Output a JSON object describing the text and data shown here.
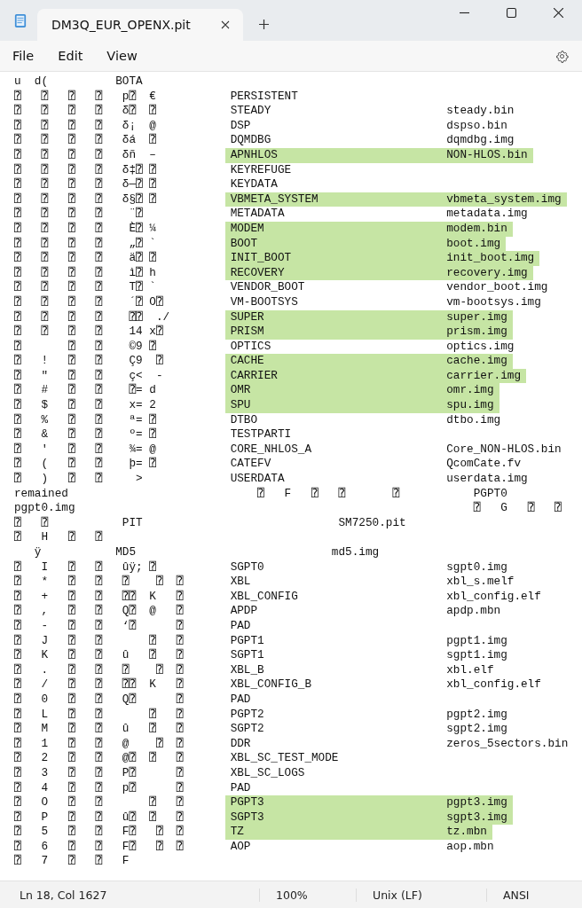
{
  "tabs": [
    {
      "label": "DM3Q_EUR_OPENX.pit",
      "selected": true
    }
  ],
  "menu": [
    "File",
    "Edit",
    "View"
  ],
  "lines": [
    {
      "kind": "text",
      "text": "u  d(          BOTA"
    },
    {
      "kind": "entry",
      "left": "⍰\t⍰\t⍰\t⍰\tp⍰\t€",
      "name": "PERSISTENT",
      "highlighted": false
    },
    {
      "kind": "entry",
      "left": "⍰\t⍰\t⍰\t⍰\tδ⍰\t⍰",
      "name": "STEADY",
      "file": "steady.bin",
      "highlighted": false
    },
    {
      "kind": "entry",
      "left": "⍰\t⍰\t⍰\t⍰\tδ¡\t@",
      "name": "DSP",
      "file": "dspso.bin",
      "highlighted": false
    },
    {
      "kind": "entry",
      "left": "⍰\t⍰\t⍰\t⍰\tδá\t⍰",
      "name": "DQMDBG",
      "file": "dqmdbg.img",
      "highlighted": false
    },
    {
      "kind": "entry",
      "left": "⍰\t⍰\t⍰\t⍰\tδñ\t–",
      "name": "APNHLOS",
      "file": "NON-HLOS.bin",
      "highlighted": true
    },
    {
      "kind": "entry",
      "left": "⍰\t⍰\t⍰\t⍰\tδ‡⍰\t⍰",
      "name": "KEYREFUGE",
      "highlighted": false
    },
    {
      "kind": "entry",
      "left": "⍰\t⍰\t⍰\t⍰\tδ—⍰\t⍰",
      "name": "KEYDATA",
      "highlighted": false
    },
    {
      "kind": "entry",
      "left": "⍰\t⍰\t⍰\t⍰\tδ§⍰ ⍰",
      "name": "VBMETA_SYSTEM",
      "file": "vbmeta_system.img",
      "highlighted": true
    },
    {
      "kind": "entry",
      "left": "⍰\t⍰\t⍰\t⍰\t ¨⍰",
      "name": "METADATA",
      "file": "metadata.img",
      "highlighted": false
    },
    {
      "kind": "entry",
      "left": "⍰\t⍰\t⍰\t⍰\t È⍰\t¼",
      "name": "MODEM",
      "file": "modem.bin",
      "highlighted": true
    },
    {
      "kind": "entry",
      "left": "⍰\t⍰\t⍰\t⍰\t „⍰\t`",
      "name": "BOOT",
      "file": "boot.img",
      "highlighted": true
    },
    {
      "kind": "entry",
      "left": "⍰\t⍰\t⍰\t⍰\t ä⍰\t⍰",
      "name": "INIT_BOOT",
      "file": "init_boot.img",
      "highlighted": true
    },
    {
      "kind": "entry",
      "left": "⍰\t⍰\t⍰\t⍰\t ì⍰\th",
      "name": "RECOVERY",
      "file": "recovery.img",
      "highlighted": true
    },
    {
      "kind": "entry",
      "left": "⍰\t⍰\t⍰\t⍰\t T⍰\t`",
      "name": "VENDOR_BOOT",
      "file": "vendor_boot.img",
      "highlighted": false
    },
    {
      "kind": "entry",
      "left": "⍰\t⍰\t⍰\t⍰\t ´⍰\tO⍰",
      "name": "VM-BOOTSYS",
      "file": "vm-bootsys.img",
      "highlighted": false
    },
    {
      "kind": "entry",
      "left": "⍰\t⍰\t⍰\t⍰\t ⍰⍰\t ./",
      "name": "SUPER",
      "file": "super.img",
      "highlighted": true
    },
    {
      "kind": "entry",
      "left": "⍰\t⍰\t⍰\t⍰\t 14\tx⍰",
      "name": "PRISM",
      "file": "prism.img",
      "highlighted": true
    },
    {
      "kind": "entry",
      "left": "⍰\t\t⍰\t⍰\t ©9\t⍰",
      "name": "OPTICS",
      "file": "optics.img",
      "highlighted": false
    },
    {
      "kind": "entry",
      "left": "⍰\t!\t⍰\t⍰\t Ç9\t ⍰",
      "name": "CACHE",
      "file": "cache.img",
      "highlighted": true
    },
    {
      "kind": "entry",
      "left": "⍰\t\"\t⍰\t⍰\t ç<\t -",
      "name": "CARRIER",
      "file": "carrier.img",
      "highlighted": true
    },
    {
      "kind": "entry",
      "left": "⍰\t#\t⍰\t⍰\t ⍰=\td",
      "name": "OMR",
      "file": "omr.img",
      "highlighted": true
    },
    {
      "kind": "entry",
      "left": "⍰\t$\t⍰\t⍰\t x=\t2",
      "name": "SPU",
      "file": "spu.img",
      "highlighted": true
    },
    {
      "kind": "entry",
      "left": "⍰\t%\t⍰\t⍰\t ª=\t⍰",
      "name": "DTBO",
      "file": "dtbo.img",
      "highlighted": false
    },
    {
      "kind": "entry",
      "left": "⍰\t&\t⍰\t⍰\t º=\t⍰",
      "name": "TESTPARTI",
      "highlighted": false
    },
    {
      "kind": "entry",
      "left": "⍰\t'\t⍰\t⍰\t ¾=\t@",
      "name": "CORE_NHLOS_A",
      "file": "Core_NON-HLOS.bin",
      "highlighted": false
    },
    {
      "kind": "entry",
      "left": "⍰\t(\t⍰\t⍰\t þ=\t⍰",
      "name": "CATEFV",
      "file": "QcomCate.fv",
      "highlighted": false
    },
    {
      "kind": "entry",
      "left": "⍰\t)\t⍰\t⍰\t  >",
      "name": "USERDATA",
      "file": "userdata.img",
      "highlighted": false
    },
    {
      "kind": "text",
      "text": "remained\t\t\t\t\t\t\t⍰\tF\t⍰\t⍰\t\t⍰\t\t\tPGPT0"
    },
    {
      "kind": "text",
      "text": "pgpt0.img\t\t\t\t\t\t\t\t\t\t\t\t\t\t\t⍰\tG\t⍰\t⍰"
    },
    {
      "kind": "text",
      "text": "⍰\t⍰\t\t\tPIT\t\t\t\t\t\t\t\tSM7250.pit"
    },
    {
      "kind": "text",
      "text": "⍰\tH\t⍰\t⍰"
    },
    {
      "kind": "text",
      "text": "   ÿ           MD5                             md5.img"
    },
    {
      "kind": "entry",
      "left": "⍰\tI\t⍰\t⍰\tûÿ;\t⍰",
      "name": "SGPT0",
      "file": "sgpt0.img",
      "highlighted": false
    },
    {
      "kind": "entry",
      "left": "⍰\t*\t⍰\t⍰\t⍰\t ⍰\t⍰",
      "name": "XBL",
      "file": "xbl_s.melf",
      "highlighted": false
    },
    {
      "kind": "entry",
      "left": "⍰\t+\t⍰\t⍰\t⍰⍰\tK\t⍰",
      "name": "XBL_CONFIG",
      "file": "xbl_config.elf",
      "highlighted": false
    },
    {
      "kind": "entry",
      "left": "⍰\t,\t⍰\t⍰\tQ⍰\t@\t⍰",
      "name": "APDP",
      "file": "apdp.mbn",
      "highlighted": false
    },
    {
      "kind": "entry",
      "left": "⍰\t-\t⍰\t⍰\t‘⍰\t\t⍰",
      "name": "PAD",
      "highlighted": false
    },
    {
      "kind": "entry",
      "left": "⍰\tJ\t⍰\t⍰\t\t⍰\t⍰",
      "name": "PGPT1",
      "file": "pgpt1.img",
      "highlighted": false
    },
    {
      "kind": "entry",
      "left": "⍰\tK\t⍰\t⍰\tû\t⍰\t⍰",
      "name": "SGPT1",
      "file": "sgpt1.img",
      "highlighted": false
    },
    {
      "kind": "entry",
      "left": "⍰\t.\t⍰\t⍰\t⍰\t ⍰\t⍰",
      "name": "XBL_B",
      "file": "xbl.elf",
      "highlighted": false
    },
    {
      "kind": "entry",
      "left": "⍰\t/\t⍰\t⍰\t⍰⍰\tK\t⍰",
      "name": "XBL_CONFIG_B",
      "file": "xbl_config.elf",
      "highlighted": false
    },
    {
      "kind": "entry",
      "left": "⍰\t0\t⍰\t⍰\tQ⍰\t\t⍰",
      "name": "PAD",
      "highlighted": false
    },
    {
      "kind": "entry",
      "left": "⍰\tL\t⍰\t⍰\t\t⍰\t⍰",
      "name": "PGPT2",
      "file": "pgpt2.img",
      "highlighted": false
    },
    {
      "kind": "entry",
      "left": "⍰\tM\t⍰\t⍰\tû\t⍰\t⍰",
      "name": "SGPT2",
      "file": "sgpt2.img",
      "highlighted": false
    },
    {
      "kind": "entry",
      "left": "⍰\t1\t⍰\t⍰\t@\t ⍰\t⍰",
      "name": "DDR",
      "file": "zeros_5sectors.bin",
      "highlighted": false
    },
    {
      "kind": "entry",
      "left": "⍰\t2\t⍰\t⍰\t@⍰\t⍰\t⍰",
      "name": "XBL_SC_TEST_MODE",
      "highlighted": false
    },
    {
      "kind": "entry",
      "left": "⍰\t3\t⍰\t⍰\tP⍰\t\t⍰",
      "name": "XBL_SC_LOGS",
      "highlighted": false
    },
    {
      "kind": "entry",
      "left": "⍰\t4\t⍰\t⍰\tp⍰\t\t⍰",
      "name": "PAD",
      "highlighted": false
    },
    {
      "kind": "entry",
      "left": "⍰\tO\t⍰\t⍰\t\t⍰\t⍰",
      "name": "PGPT3",
      "file": "pgpt3.img",
      "highlighted": true
    },
    {
      "kind": "entry",
      "left": "⍰\tP\t⍰\t⍰\tû⍰\t⍰\t⍰",
      "name": "SGPT3",
      "file": "sgpt3.img",
      "highlighted": true
    },
    {
      "kind": "entry",
      "left": "⍰\t5\t⍰\t⍰\tF⍰\t ⍰\t⍰",
      "name": "TZ",
      "file": "tz.mbn",
      "highlighted": true
    },
    {
      "kind": "entry",
      "left": "⍰\t6\t⍰\t⍰\tF⍰\t ⍰\t⍰",
      "name": "AOP",
      "file": "aop.mbn",
      "highlighted": false
    },
    {
      "kind": "text",
      "text": "⍰\t7\t⍰\t⍰\tF"
    }
  ],
  "status_bar": [
    "Ln 18, Col 1627",
    "100%",
    "Unix (LF)",
    "ANSI"
  ]
}
